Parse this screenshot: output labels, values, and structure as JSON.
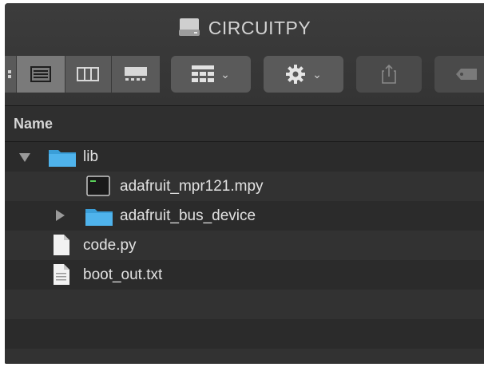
{
  "window": {
    "title": "CIRCUITPY"
  },
  "toolbar": {
    "view_modes": [
      {
        "name": "icon-view",
        "active": false
      },
      {
        "name": "list-view",
        "active": true
      },
      {
        "name": "column-view",
        "active": false
      },
      {
        "name": "gallery-view",
        "active": false
      }
    ],
    "group_caret": "⌄",
    "action_caret": "⌄"
  },
  "list": {
    "column_header": "Name",
    "rows": [
      {
        "label": "lib",
        "icon": "folder-icon",
        "disclosure": "expanded"
      },
      {
        "label": "adafruit_mpr121.mpy",
        "icon": "executable-file-icon"
      },
      {
        "label": "adafruit_bus_device",
        "icon": "folder-icon",
        "disclosure": "collapsed"
      },
      {
        "label": "code.py",
        "icon": "document-icon"
      },
      {
        "label": "boot_out.txt",
        "icon": "document-icon"
      }
    ]
  },
  "colors": {
    "folder": "#3aa0dc",
    "background": "#2b2b2b",
    "row_alt": "#323232",
    "toolbar_button": "#5a5a5a"
  }
}
